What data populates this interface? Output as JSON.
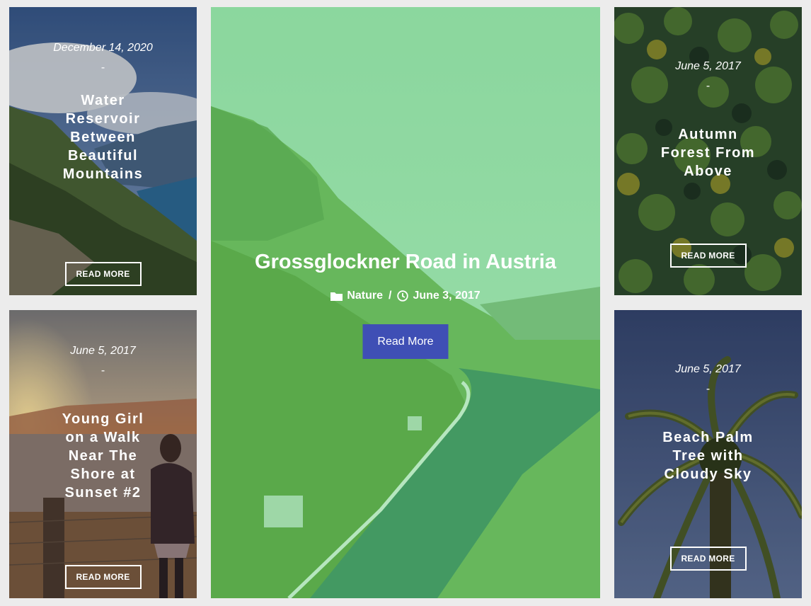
{
  "posts": {
    "water": {
      "date": "December 14, 2020",
      "separator": "-",
      "title_lines": [
        "Water",
        "Reservoir",
        "Between",
        "Beautiful",
        "Mountains"
      ],
      "button": "READ MORE"
    },
    "girl": {
      "date": "June 5, 2017",
      "separator": "-",
      "title_lines": [
        "Young Girl",
        "on a Walk",
        "Near The",
        "Shore at",
        "Sunset #2"
      ],
      "button": "READ MORE"
    },
    "featured": {
      "title": "Grossglockner Road in Austria",
      "category": "Nature",
      "meta_separator": "/",
      "date": "June 3, 2017",
      "button": "Read More",
      "button_color": "#3f4fb5",
      "overlay_color": "#4ec873"
    },
    "forest": {
      "date": "June 5, 2017",
      "separator": "-",
      "title_lines": [
        "Autumn",
        "Forest From",
        "Above"
      ],
      "button": "READ MORE"
    },
    "palm": {
      "date": "June 5, 2017",
      "separator": "-",
      "title_lines": [
        "Beach Palm",
        "Tree with",
        "Cloudy Sky"
      ],
      "button": "READ MORE"
    }
  },
  "icons": {
    "category": "folder-icon",
    "date": "clock-icon"
  }
}
